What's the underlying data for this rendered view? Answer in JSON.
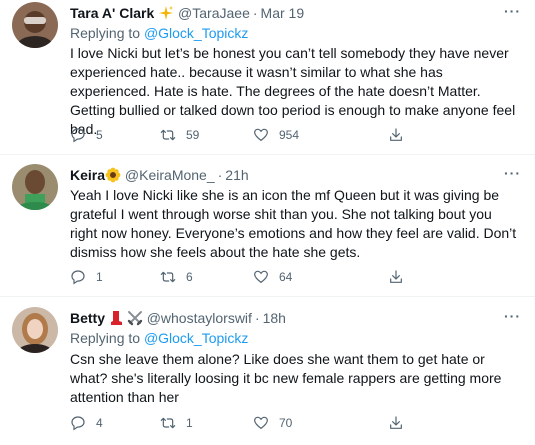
{
  "tweets": [
    {
      "name": "Tara A' Clark",
      "handle": "@TaraJaee",
      "dot": "·",
      "time": "Mar 19",
      "more": "···",
      "replying_prefix": "Replying to",
      "replying_to": "@Glock_Topickz",
      "text": "I love Nicki but let’s be honest you can’t tell somebody they have never experienced hate.. because it wasn’t similar to what she has experienced. Hate is hate. The degrees of the hate doesn’t Matter. Getting bullied or talked down too period is enough to make anyone feel bad.",
      "replies": "5",
      "retweets": "59",
      "likes": "954",
      "badges": [
        "sparkles-icon"
      ]
    },
    {
      "name": "Keira",
      "handle": "@KeiraMone_",
      "dot": "·",
      "time": "21h",
      "more": "···",
      "text": "Yeah I love Nicki like she is an icon the mf Queen but it was giving be grateful I went through worse shit than you. She not talking bout you right now honey. Everyone’s emotions and how they feel are valid. Don’t dismiss how she feels about the hate she gets.",
      "replies": "1",
      "retweets": "6",
      "likes": "64",
      "badges": [
        "sunflower-icon"
      ]
    },
    {
      "name": "Betty",
      "handle": "@whostaylorswif",
      "dot": "·",
      "time": "18h",
      "more": "···",
      "replying_prefix": "Replying to",
      "replying_to": "@Glock_Topickz",
      "text": "Csn she leave them alone? Like does she want them to get hate or what? she's literally loosing it bc new female rappers are getting more attention than her",
      "replies": "4",
      "retweets": "1",
      "likes": "70",
      "badges": [
        "red-boot-icon",
        "crossed-swords-icon"
      ]
    }
  ],
  "colors": {
    "text": "#0f1419",
    "secondary": "#536471",
    "link": "#1d9bf0",
    "divider": "#eff3f4"
  }
}
